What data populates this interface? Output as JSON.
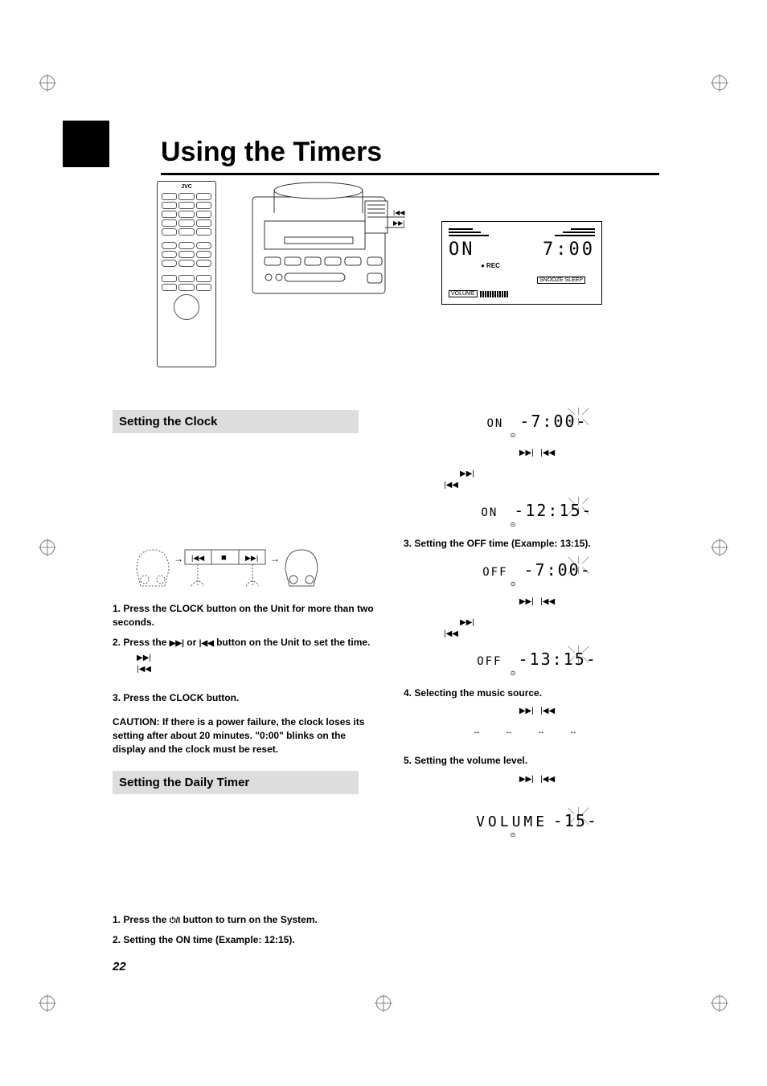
{
  "page_number": "22",
  "title": "Using the Timers",
  "remote_brand": "JVC",
  "lcd_main": {
    "status": "ON",
    "time": "7:00",
    "rec": "● REC",
    "snooze": "SNOOZE  SLEEP",
    "volume_label": "VOLUME"
  },
  "arrow_fwd": "▶▶|",
  "arrow_rew": "|◀◀",
  "col_left": {
    "section1": "Setting the Clock",
    "step1": "1. Press the CLOCK button on the Unit for more than two seconds.",
    "step2_a": "2. Press the ",
    "step2_b": " or ",
    "step2_c": " button on the Unit to set the time.",
    "step3": "3. Press the CLOCK button.",
    "caution_label": "CAUTION:",
    "caution_text": " If there is a power failure, the clock loses its setting after about 20 minutes. \"0:00\" blinks on the display and the clock must be reset.",
    "section2": "Setting the Daily Timer",
    "daily_step1_a": "1. Press the ",
    "daily_step1_b": " button to turn on the System.",
    "daily_step2": "2. Setting the ON time (Example: 12:15)."
  },
  "col_right": {
    "lcd1_label": "ON",
    "lcd1_time": "-7:00-",
    "lcd2_label": "ON",
    "lcd2_time": "-12:15-",
    "step3": "3. Setting the OFF time (Example: 13:15).",
    "lcd3_label": "OFF",
    "lcd3_time": "-7:00-",
    "lcd4_label": "OFF",
    "lcd4_time": "-13:15-",
    "step4": "4. Selecting the music source.",
    "step5": "5. Setting the volume level.",
    "lcd5_label": "VOLUME",
    "lcd5_value": "-15-"
  },
  "double_arrow": "↔"
}
